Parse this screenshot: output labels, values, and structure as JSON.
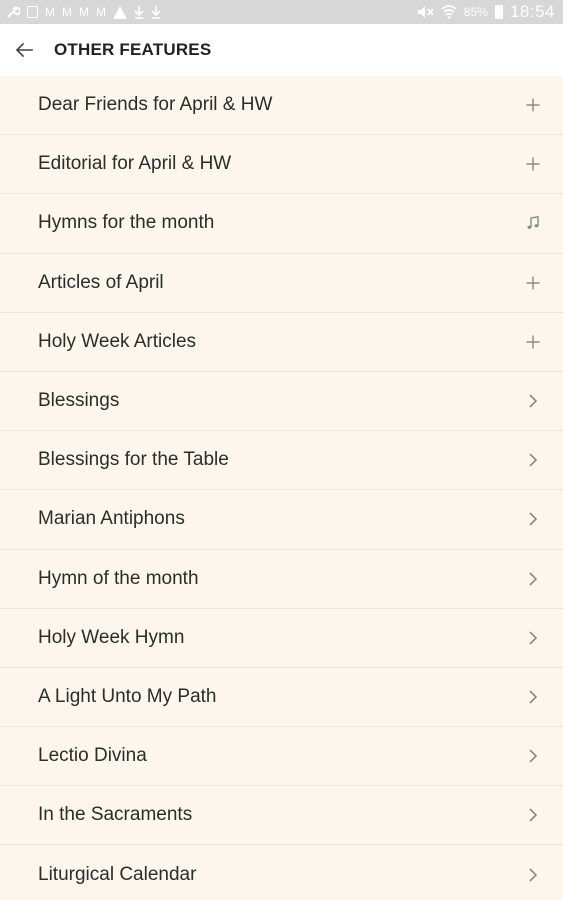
{
  "status_bar": {
    "left_icons": [
      "wrench-icon",
      "mail-icon",
      "gmail-icon",
      "gmail-icon",
      "gmail-icon",
      "gmail-icon",
      "warning-icon",
      "download-icon",
      "download-icon"
    ],
    "gmail_glyph": "M",
    "battery": "85%",
    "time": "18:54"
  },
  "toolbar": {
    "title": "OTHER FEATURES"
  },
  "list": {
    "items": [
      {
        "label": "Dear Friends for April & HW",
        "icon": "plus-icon"
      },
      {
        "label": "Editorial for April & HW",
        "icon": "plus-icon"
      },
      {
        "label": "Hymns for the month",
        "icon": "music-note-icon"
      },
      {
        "label": "Articles of April",
        "icon": "plus-icon"
      },
      {
        "label": "Holy Week Articles",
        "icon": "plus-icon"
      },
      {
        "label": "Blessings",
        "icon": "chevron-right-icon"
      },
      {
        "label": "Blessings for the Table",
        "icon": "chevron-right-icon"
      },
      {
        "label": "Marian Antiphons",
        "icon": "chevron-right-icon"
      },
      {
        "label": "Hymn of the month",
        "icon": "chevron-right-icon"
      },
      {
        "label": "Holy Week Hymn",
        "icon": "chevron-right-icon"
      },
      {
        "label": "A Light Unto My Path",
        "icon": "chevron-right-icon"
      },
      {
        "label": "Lectio Divina",
        "icon": "chevron-right-icon"
      },
      {
        "label": "In the Sacraments",
        "icon": "chevron-right-icon"
      },
      {
        "label": "Liturgical Calendar",
        "icon": "chevron-right-icon"
      }
    ]
  },
  "colors": {
    "list_background": "#fcf6ec",
    "divider": "#ece4d6",
    "icon": "#8a8a8a",
    "status_bar": "#d7d7d7"
  }
}
